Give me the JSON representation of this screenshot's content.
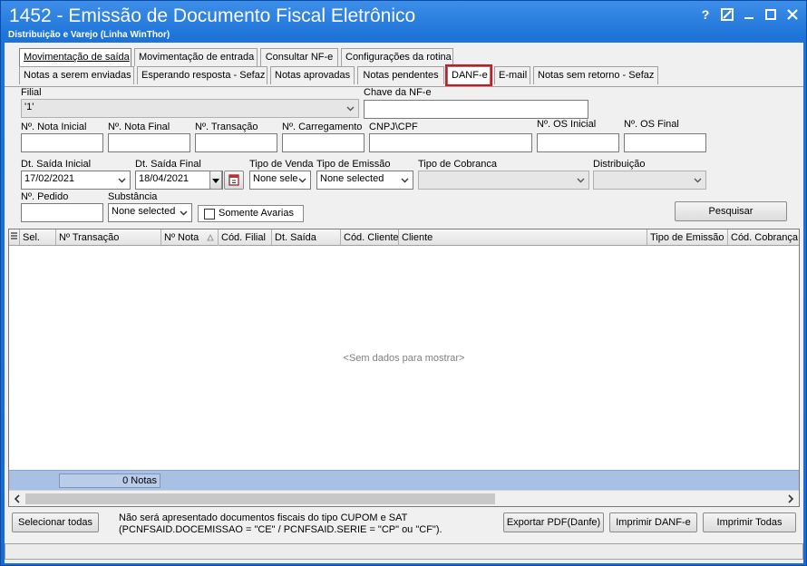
{
  "window": {
    "title": "1452 - Emissão de Documento Fiscal Eletrônico",
    "subtitle": "Distribuição e Varejo (Linha WinThor)",
    "help_label": "?"
  },
  "tabs_top": [
    {
      "label": "Movimentação de saída",
      "active": true
    },
    {
      "label": "Movimentação de entrada"
    },
    {
      "label": "Consultar NF-e"
    },
    {
      "label": "Configurações da rotina"
    }
  ],
  "tabs_sub": [
    {
      "label": "Notas a serem enviadas"
    },
    {
      "label": "Esperando resposta - Sefaz"
    },
    {
      "label": "Notas aprovadas"
    },
    {
      "label": "Notas pendentes"
    },
    {
      "label": "DANF-e",
      "active": true,
      "highlight": true
    },
    {
      "label": "E-mail"
    },
    {
      "label": "Notas sem retorno - Sefaz"
    }
  ],
  "form": {
    "filial": {
      "label": "Filial",
      "value": "'1'"
    },
    "chave": {
      "label": "Chave da NF-e",
      "value": ""
    },
    "nota_inicial": {
      "label": "Nº. Nota Inicial",
      "value": ""
    },
    "nota_final": {
      "label": "Nº. Nota Final",
      "value": ""
    },
    "transacao": {
      "label": "Nº. Transação",
      "value": ""
    },
    "carregamento": {
      "label": "Nº. Carregamento",
      "value": ""
    },
    "cnpj": {
      "label": "CNPJ\\CPF",
      "value": ""
    },
    "os_inicial": {
      "label": "Nº. OS Inicial",
      "value": ""
    },
    "os_final": {
      "label": "Nº. OS Final",
      "value": ""
    },
    "dt_saida_inicial": {
      "label": "Dt. Saída Inicial",
      "value": "17/02/2021"
    },
    "dt_saida_final": {
      "label": "Dt. Saída Final",
      "value": "18/04/2021"
    },
    "tipo_venda": {
      "label": "Tipo de Venda",
      "value": "None sele"
    },
    "tipo_emissao": {
      "label": "Tipo de Emissão",
      "value": "None selected"
    },
    "tipo_cobranca": {
      "label": "Tipo de Cobranca",
      "value": ""
    },
    "distribuicao": {
      "label": "Distribuição",
      "value": ""
    },
    "pedido": {
      "label": "Nº. Pedido",
      "value": ""
    },
    "substancia": {
      "label": "Substância",
      "value": "None selected"
    },
    "somente_avarias": {
      "label": "Somente Avarias",
      "checked": false
    },
    "pesquisar": "Pesquisar"
  },
  "grid": {
    "columns": [
      "Sel.",
      "Nº Transação",
      "Nº Nota",
      "Cód. Filial",
      "Dt. Saída",
      "Cód. Cliente",
      "Cliente",
      "Tipo de Emissão",
      "Cód. Cobrança"
    ],
    "empty_text": "<Sem dados para mostrar>",
    "footer_count": "0 Notas"
  },
  "bottom": {
    "select_all": "Selecionar todas",
    "note_line1": "Não será apresentado documentos fiscais do tipo CUPOM e SAT",
    "note_line2": "(PCNFSAID.DOCEMISSAO = \"CE\" / PCNFSAID.SERIE = \"CP\" ou \"CF\").",
    "export_pdf": "Exportar PDF(Danfe)",
    "print_danfe": "Imprimir DANF-e",
    "print_all": "Imprimir Todas"
  },
  "colors": {
    "title_bar": "#1d73d8",
    "highlight": "#e0101a",
    "grid_footer": "#a8c0e4"
  }
}
